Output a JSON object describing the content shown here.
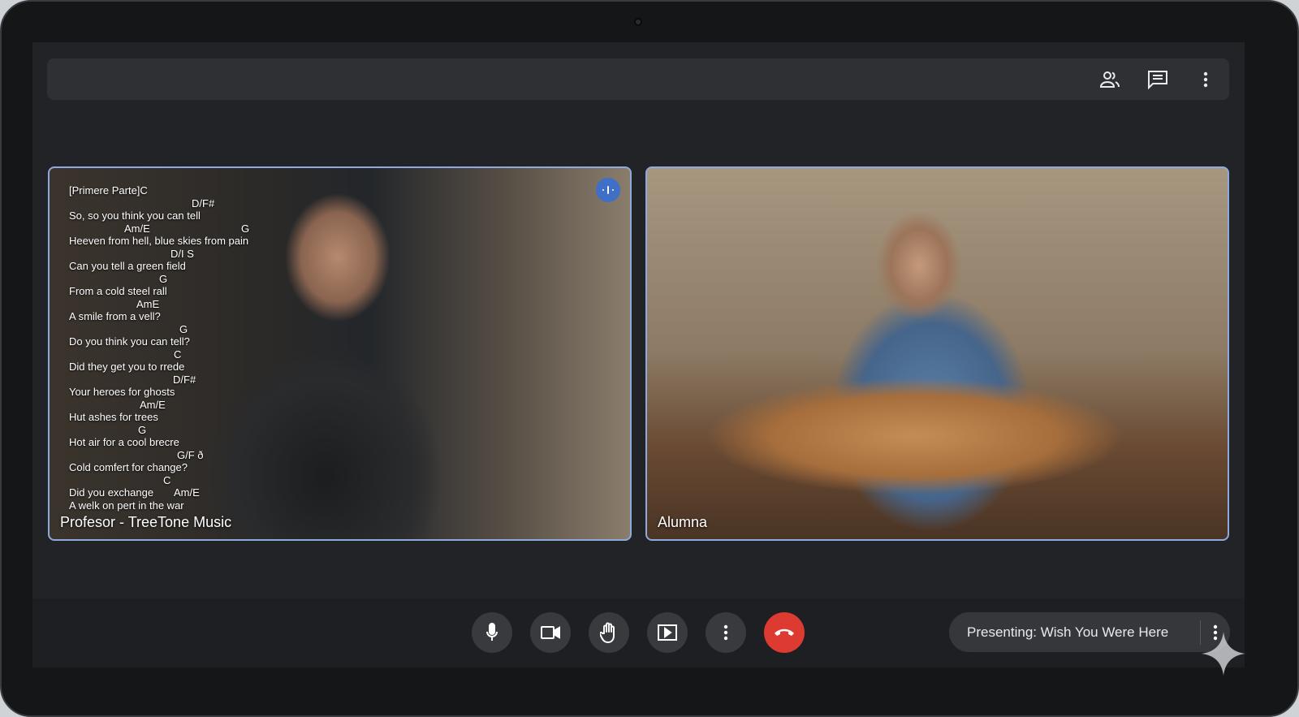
{
  "top_bar": {
    "icons": [
      "people-icon",
      "chat-icon",
      "more-vert-icon"
    ]
  },
  "tiles": [
    {
      "name": "Profesor - TreeTone Music",
      "speaking": true,
      "lyrics": [
        {
          "type": "text",
          "text": "[Primere Parte]C"
        },
        {
          "type": "chord",
          "chords": [
            "D/F#"
          ]
        },
        {
          "type": "text",
          "text": "So, so you think you can tell"
        },
        {
          "type": "chord",
          "chords": [
            "Am/E",
            "G"
          ]
        },
        {
          "type": "text",
          "text": "Heeven from hell, blue skies from pain"
        },
        {
          "type": "chord",
          "chords": [
            "D/I S"
          ]
        },
        {
          "type": "text",
          "text": "Can you tell a green field"
        },
        {
          "type": "chord",
          "chords": [
            "G"
          ]
        },
        {
          "type": "text",
          "text": "From a cold steel rall"
        },
        {
          "type": "chord",
          "chords": [
            "AmE"
          ]
        },
        {
          "type": "text",
          "text": "A smile from a vell?"
        },
        {
          "type": "chord",
          "chords": [
            "G"
          ]
        },
        {
          "type": "text",
          "text": "Do you think you can tell?"
        },
        {
          "type": "chord",
          "chords": [
            "C"
          ]
        },
        {
          "type": "text",
          "text": "Did they get you to rrede"
        },
        {
          "type": "chord",
          "chords": [
            "D/F#"
          ]
        },
        {
          "type": "text",
          "text": "Your heroes for ghosts"
        },
        {
          "type": "chord",
          "chords": [
            "Am/E"
          ]
        },
        {
          "type": "text",
          "text": "Hut ashes for trees"
        },
        {
          "type": "chord",
          "chords": [
            "G"
          ]
        },
        {
          "type": "text",
          "text": "Hot air for a cool brecre"
        },
        {
          "type": "chord",
          "chords": [
            "G/F ð"
          ]
        },
        {
          "type": "text",
          "text": "Cold comfert for change?"
        },
        {
          "type": "chord",
          "chords": [
            "C"
          ]
        },
        {
          "type": "text",
          "text": "Did you exchange",
          "chords": [
            "Am/E"
          ]
        },
        {
          "type": "text",
          "text": "A welk on pert in the war"
        }
      ]
    },
    {
      "name": "Alumna",
      "speaking": false
    }
  ],
  "controls": {
    "buttons": [
      "microphone",
      "camera",
      "raise-hand",
      "present",
      "more-options",
      "end-call"
    ],
    "presenting_label": "Presenting: Wish You Were Here"
  },
  "colors": {
    "accent_border": "#8fa9dc",
    "end_call": "#dd3b32",
    "speaking": "#3f6fc6"
  }
}
